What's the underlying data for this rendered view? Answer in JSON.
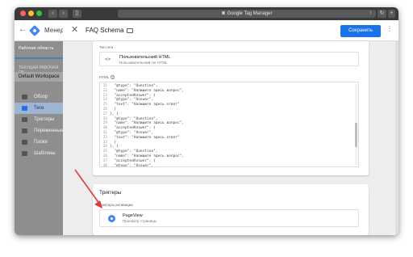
{
  "browser": {
    "url_text": "Google Tag Manager"
  },
  "app": {
    "title": "Менед"
  },
  "sidebar": {
    "tab_label": "Рабочая область",
    "workspace_label": "ТЕКУЩАЯ РАБОЧАЯ ОБ",
    "workspace_name": "Default Workspace",
    "items": [
      {
        "label": "Обзор",
        "icon": "overview-icon",
        "active": false
      },
      {
        "label": "Теги",
        "icon": "tag-icon",
        "active": true
      },
      {
        "label": "Триггеры",
        "icon": "trigger-icon",
        "active": false
      },
      {
        "label": "Переменные",
        "icon": "variable-icon",
        "active": false
      },
      {
        "label": "Папки",
        "icon": "folder-icon",
        "active": false
      },
      {
        "label": "Шаблоны",
        "icon": "template-icon",
        "active": false
      }
    ]
  },
  "tag_panel": {
    "title": "FAQ Schema",
    "save_label": "Сохранить",
    "tag_type_label": "Тип тега",
    "tag_type_name": "Пользовательский HTML",
    "tag_type_desc": "Пользовательский тег HTML",
    "html_label": "HTML",
    "code_lines": [
      {
        "num": "21",
        "text": "  \"@type\": \"Question\","
      },
      {
        "num": "22",
        "text": "  \"name\": \"Напишите здесь вопрос\","
      },
      {
        "num": "23",
        "text": "  \"acceptedAnswer\": {"
      },
      {
        "num": "24",
        "text": "  \"@type\": \"Answer\","
      },
      {
        "num": "25",
        "text": "  \"text\": \"Напишите здесь ответ\""
      },
      {
        "num": "26",
        "text": "  }"
      },
      {
        "num": "27",
        "text": "}, {"
      },
      {
        "num": "28",
        "text": "  \"@type\": \"Question\","
      },
      {
        "num": "29",
        "text": "  \"name\": \"Напишите здесь вопрос\","
      },
      {
        "num": "30",
        "text": "  \"acceptedAnswer\": {"
      },
      {
        "num": "31",
        "text": "  \"@type\": \"Answer\","
      },
      {
        "num": "32",
        "text": "  \"text\": \"Напишите здесь ответ\""
      },
      {
        "num": "33",
        "text": "  }"
      },
      {
        "num": "34",
        "text": "}, {"
      },
      {
        "num": "35",
        "text": "  \"@type\": \"Question\","
      },
      {
        "num": "36",
        "text": "  \"name\": \"Напишите здесь вопрос\","
      },
      {
        "num": "37",
        "text": "  \"acceptedAnswer\": {"
      },
      {
        "num": "38",
        "text": "  \"@type\": \"Answer\","
      }
    ],
    "triggers_title": "Триггеры",
    "firing_label": "Триггеры активации",
    "trigger_name": "PageView",
    "trigger_desc": "Просмотр страницы"
  },
  "colors": {
    "accent": "#1a73e8",
    "annotation": "#e53935"
  }
}
